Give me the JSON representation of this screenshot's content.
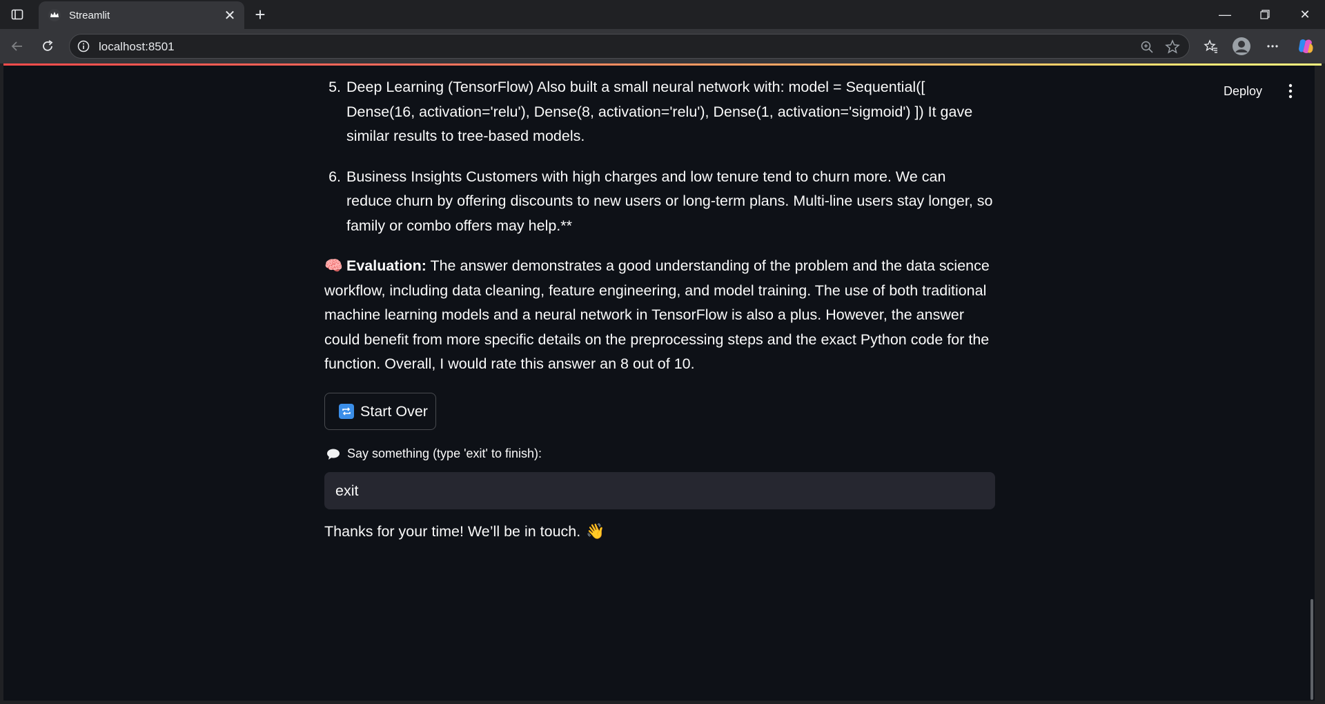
{
  "browser": {
    "tab_title": "Streamlit",
    "url": "localhost:8501"
  },
  "app": {
    "deploy_label": "Deploy",
    "list_items": [
      {
        "number": "5.",
        "text": "Deep Learning (TensorFlow) Also built a small neural network with: model = Sequential([ Dense(16, activation='relu'), Dense(8, activation='relu'), Dense(1, activation='sigmoid') ]) It gave similar results to tree-based models."
      },
      {
        "number": "6.",
        "text": "Business Insights Customers with high charges and low tenure tend to churn more. We can reduce churn by offering discounts to new users or long-term plans. Multi-line users stay longer, so family or combo offers may help.**"
      }
    ],
    "evaluation": {
      "icon": "🧠",
      "label": "Evaluation:",
      "text": " The answer demonstrates a good understanding of the problem and the data science workflow, including data cleaning, feature engineering, and model training. The use of both traditional machine learning models and a neural network in TensorFlow is also a plus. However, the answer could benefit from more specific details on the preprocessing steps and the exact Python code for the function. Overall, I would rate this answer an 8 out of 10."
    },
    "start_over_label": "Start Over",
    "input_label": "Say something (type 'exit' to finish):",
    "input_value": "exit",
    "closing_message": "Thanks for your time! We’ll be in touch.",
    "closing_emoji": "👋"
  },
  "colors": {
    "app_bg": "#0e1117",
    "input_bg": "#262730",
    "accent_red": "#ff4b4b"
  }
}
